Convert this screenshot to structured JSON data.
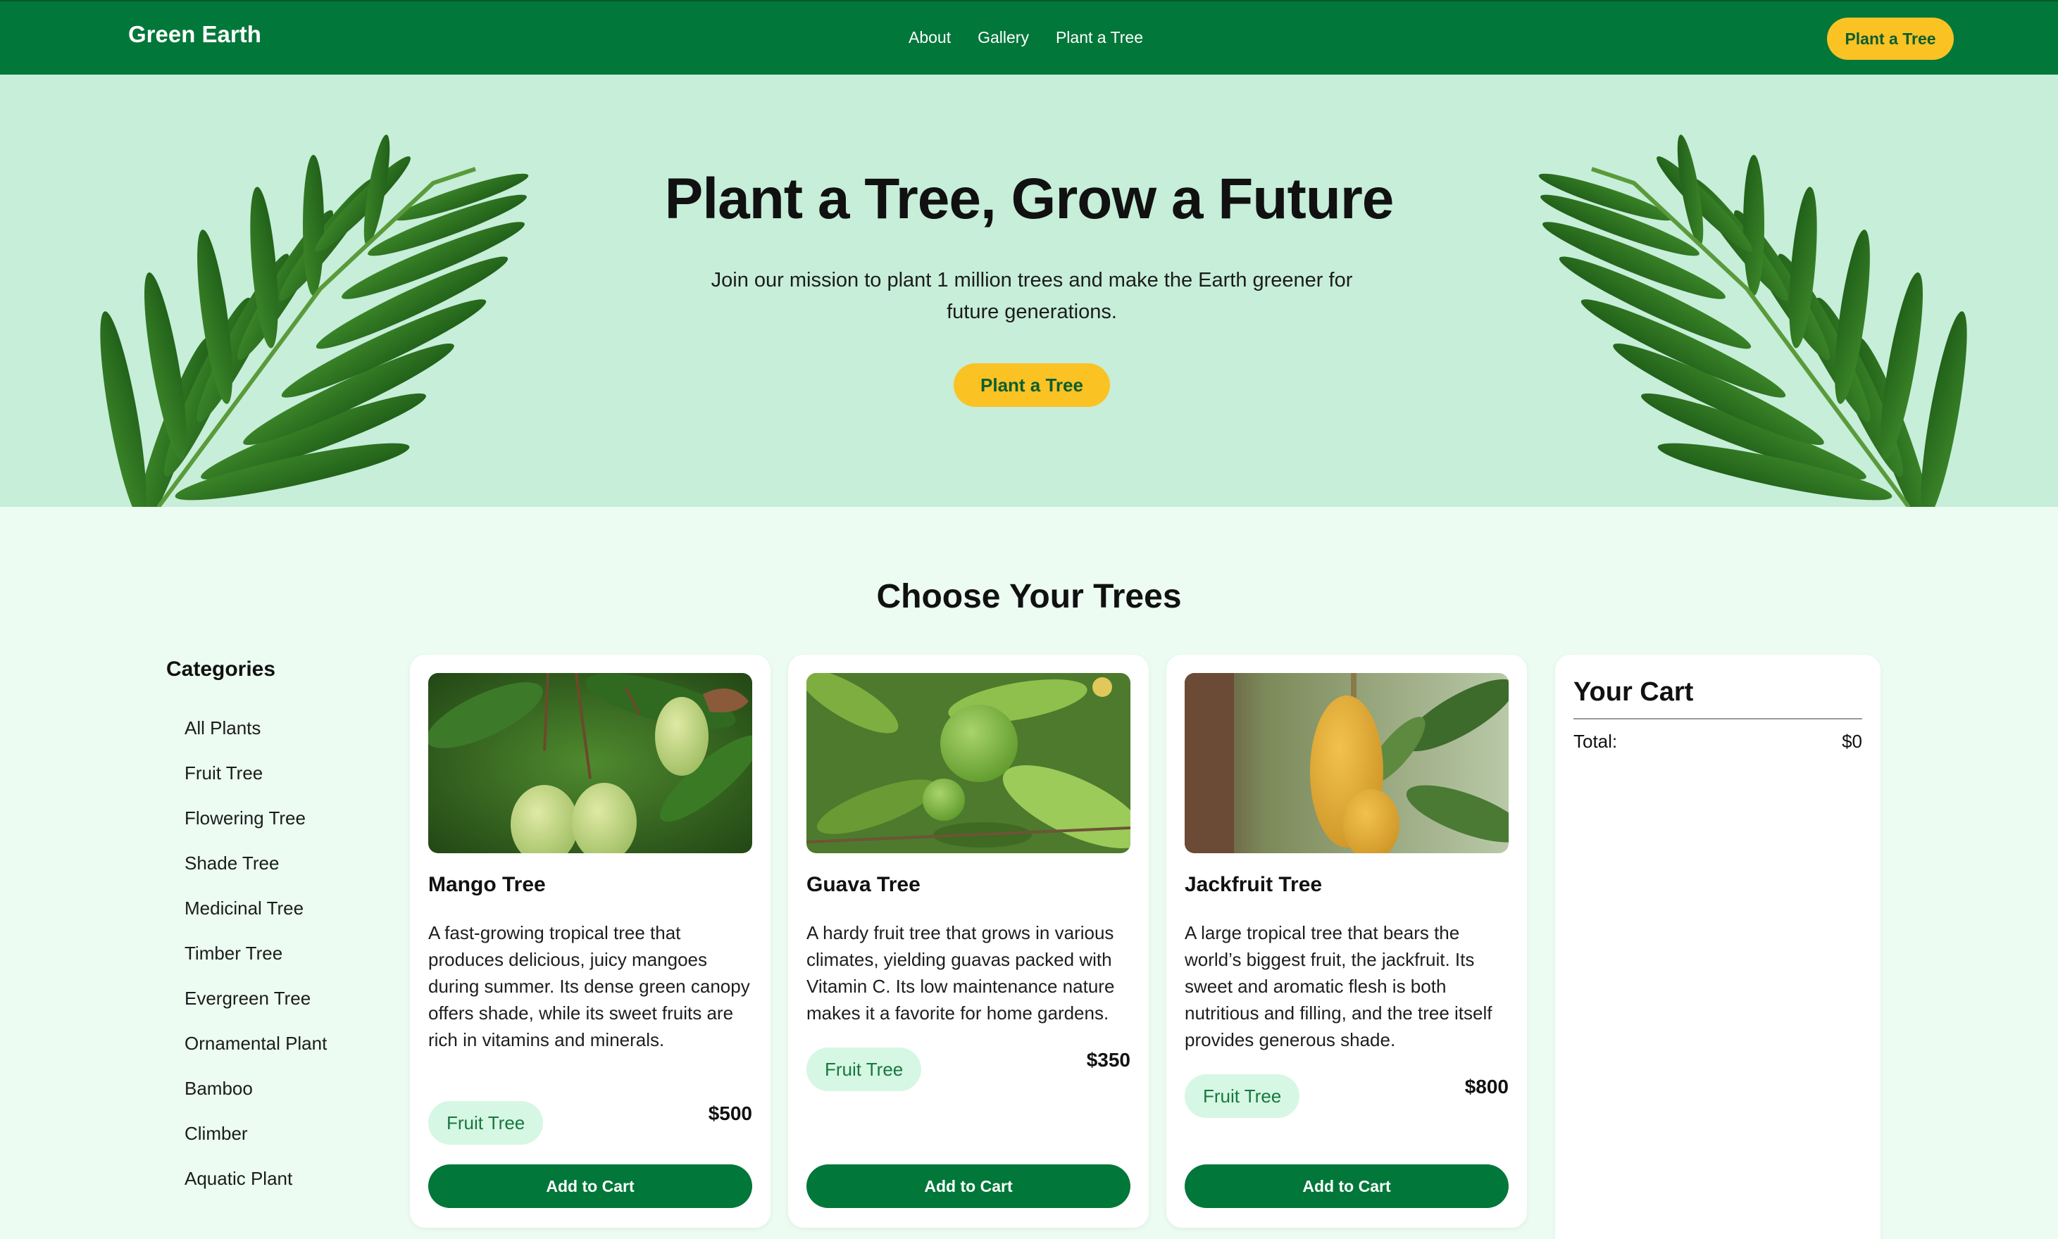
{
  "nav": {
    "brand": "Green Earth",
    "links": [
      "About",
      "Gallery",
      "Plant a Tree"
    ],
    "cta": "Plant a Tree"
  },
  "hero": {
    "title": "Plant a Tree, Grow a Future",
    "text": "Join our mission to plant 1 million trees and make the Earth greener for future generations.",
    "cta": "Plant a Tree"
  },
  "section": {
    "title": "Choose Your Trees"
  },
  "categories": {
    "heading": "Categories",
    "items": [
      "All Plants",
      "Fruit Tree",
      "Flowering Tree",
      "Shade Tree",
      "Medicinal Tree",
      "Timber Tree",
      "Evergreen Tree",
      "Ornamental Plant",
      "Bamboo",
      "Climber",
      "Aquatic Plant"
    ]
  },
  "products": [
    {
      "name": "Mango Tree",
      "description": "A fast-growing tropical tree that produces delicious, juicy mangoes during summer. Its dense green canopy offers shade, while its sweet fruits are rich in vitamins and minerals.",
      "category": "Fruit Tree",
      "price": "$500",
      "button": "Add to Cart"
    },
    {
      "name": "Guava Tree",
      "description": "A hardy fruit tree that grows in various climates, yielding guavas packed with Vitamin C. Its low maintenance nature makes it a favorite for home gardens.",
      "category": "Fruit Tree",
      "price": "$350",
      "button": "Add to Cart"
    },
    {
      "name": "Jackfruit Tree",
      "description": "A large tropical tree that bears the world’s biggest fruit, the jackfruit. Its sweet and aromatic flesh is both nutritious and filling, and the tree itself provides generous shade.",
      "category": "Fruit Tree",
      "price": "$800",
      "button": "Add to Cart"
    }
  ],
  "cart": {
    "title": "Your Cart",
    "total_label": "Total:",
    "total_value": "$0"
  },
  "colors": {
    "nav_green": "#02773a",
    "accent_yellow": "#fbc224",
    "hero_bg": "#c6eed9",
    "page_bg": "#ecfcf2",
    "tag_bg": "#d6f7e3"
  }
}
